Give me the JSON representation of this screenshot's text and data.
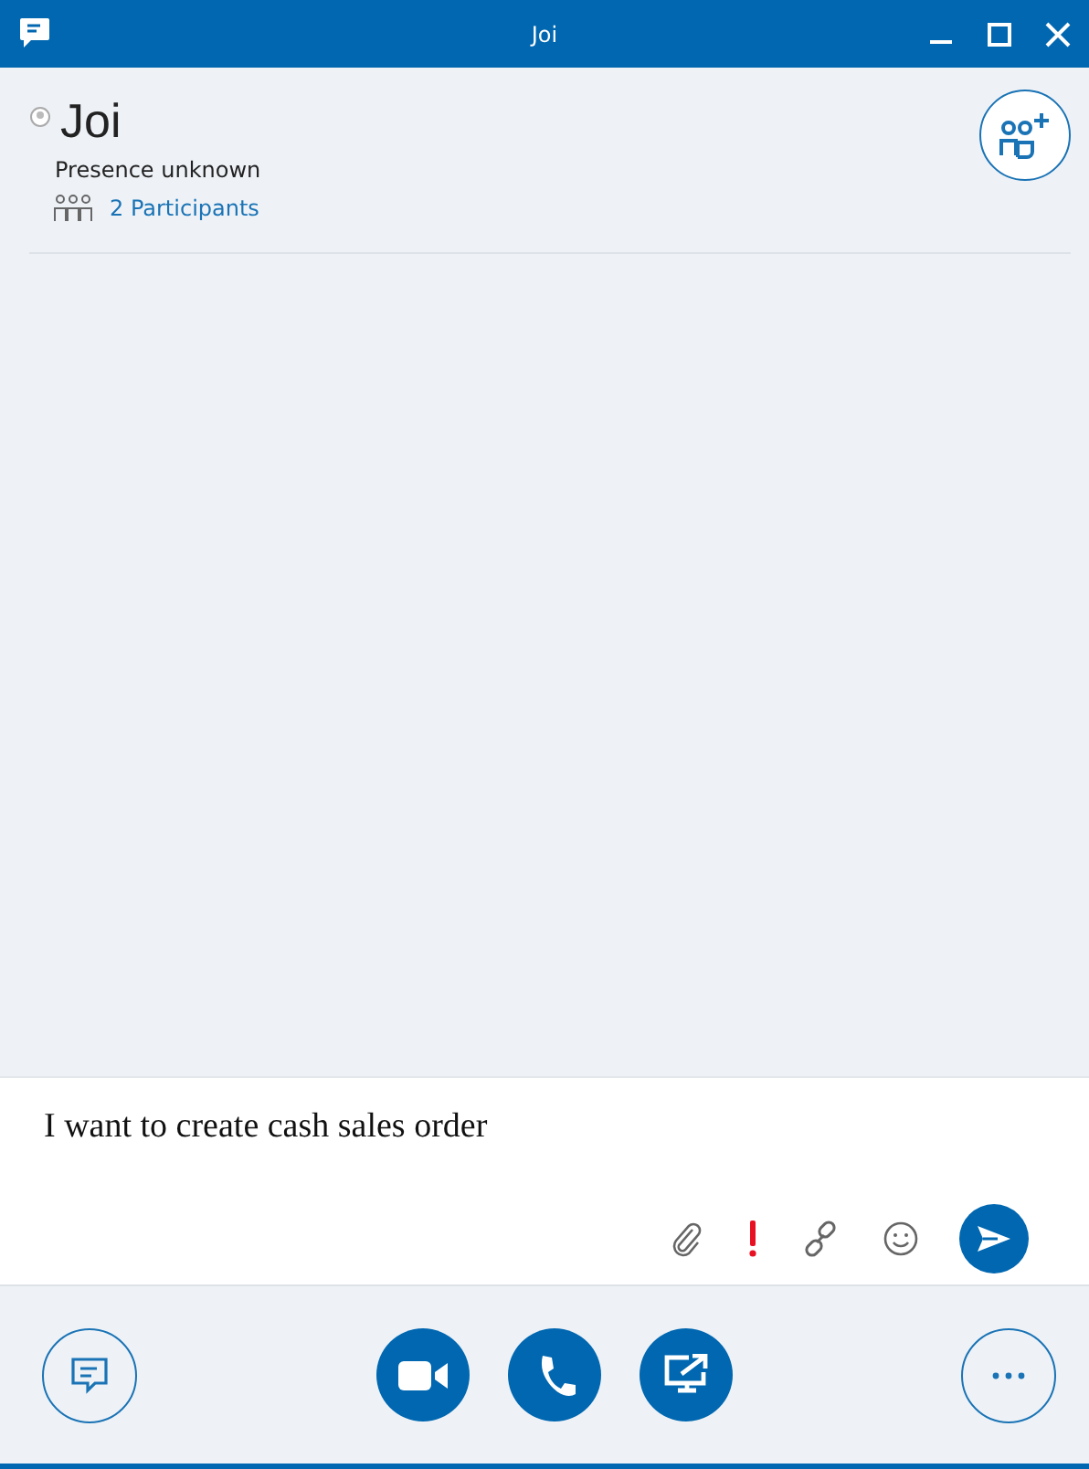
{
  "window": {
    "title": "Joi"
  },
  "contact": {
    "name": "Joi",
    "presence": "Presence unknown",
    "participants": "2 Participants"
  },
  "compose": {
    "value": "I want to create cash sales order"
  }
}
